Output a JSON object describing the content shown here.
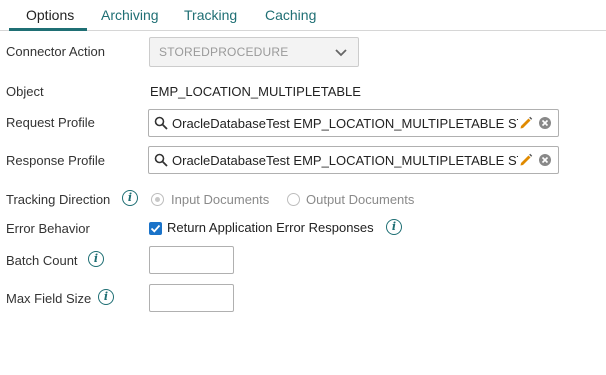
{
  "tabs": [
    {
      "label": "Options",
      "active": true
    },
    {
      "label": "Archiving",
      "active": false
    },
    {
      "label": "Tracking",
      "active": false
    },
    {
      "label": "Caching",
      "active": false
    }
  ],
  "fields": {
    "connector_action": {
      "label": "Connector Action",
      "value": "STOREDPROCEDURE"
    },
    "object": {
      "label": "Object",
      "value": "EMP_LOCATION_MULTIPLETABLE"
    },
    "request_profile": {
      "label": "Request Profile",
      "value": "OracleDatabaseTest EMP_LOCATION_MULTIPLETABLE ST"
    },
    "response_profile": {
      "label": "Response Profile",
      "value": "OracleDatabaseTest EMP_LOCATION_MULTIPLETABLE ST"
    },
    "tracking_direction": {
      "label": "Tracking Direction",
      "options": [
        "Input Documents",
        "Output Documents"
      ],
      "selected": "Input Documents"
    },
    "error_behavior": {
      "label": "Error Behavior",
      "checkbox_label": "Return Application Error Responses",
      "checked": true
    },
    "batch_count": {
      "label": "Batch Count",
      "value": ""
    },
    "max_field_size": {
      "label": "Max Field Size",
      "value": ""
    }
  },
  "colors": {
    "accent": "#1f6f74",
    "checkbox": "#1a73c9",
    "pencil": "#e08a00"
  },
  "icons": [
    "info-icon",
    "search-icon",
    "pencil-icon",
    "clear-icon",
    "chevron-down-icon"
  ]
}
